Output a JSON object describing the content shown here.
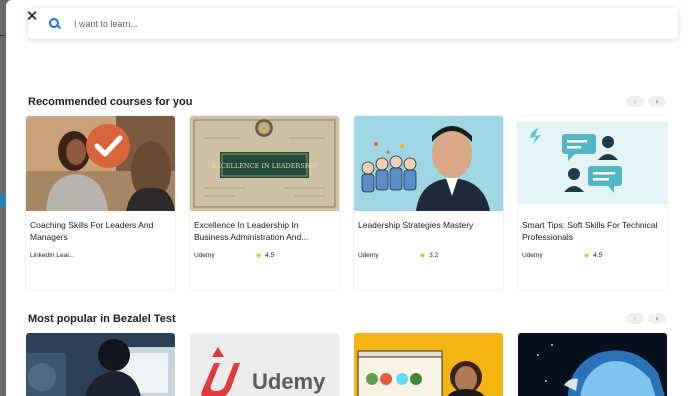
{
  "search": {
    "placeholder": "I want to learn..."
  },
  "close": {
    "glyph": "✕"
  },
  "sections": [
    {
      "title": "Recommended courses for you",
      "prev": "‹",
      "next": "›",
      "courses": [
        {
          "title": "Coaching Skills For Leaders And Managers",
          "provider": "LinkedIn Lear...",
          "rating": ""
        },
        {
          "title": "Excellence In Leadership In Business Administration And...",
          "provider": "Udemy",
          "rating": "4.5"
        },
        {
          "title": "Leadership Strategies Mastery",
          "provider": "Udemy",
          "rating": "3.2"
        },
        {
          "title": "Smart Tips: Soft Skills For Technical Professionals",
          "provider": "Udemy",
          "rating": "4.5"
        }
      ]
    },
    {
      "title": "Most popular in Bezalel Test",
      "prev": "‹",
      "next": "›",
      "thumb_text": {
        "udemy_logo": "Udemy"
      }
    }
  ],
  "thumb_text": {
    "leadership_cert": "EXCELLENCE IN LEADERSHIP"
  },
  "colors": {
    "accent": "#1e6fd9",
    "star": "#f2b01e",
    "udemy": "#a435f0"
  }
}
